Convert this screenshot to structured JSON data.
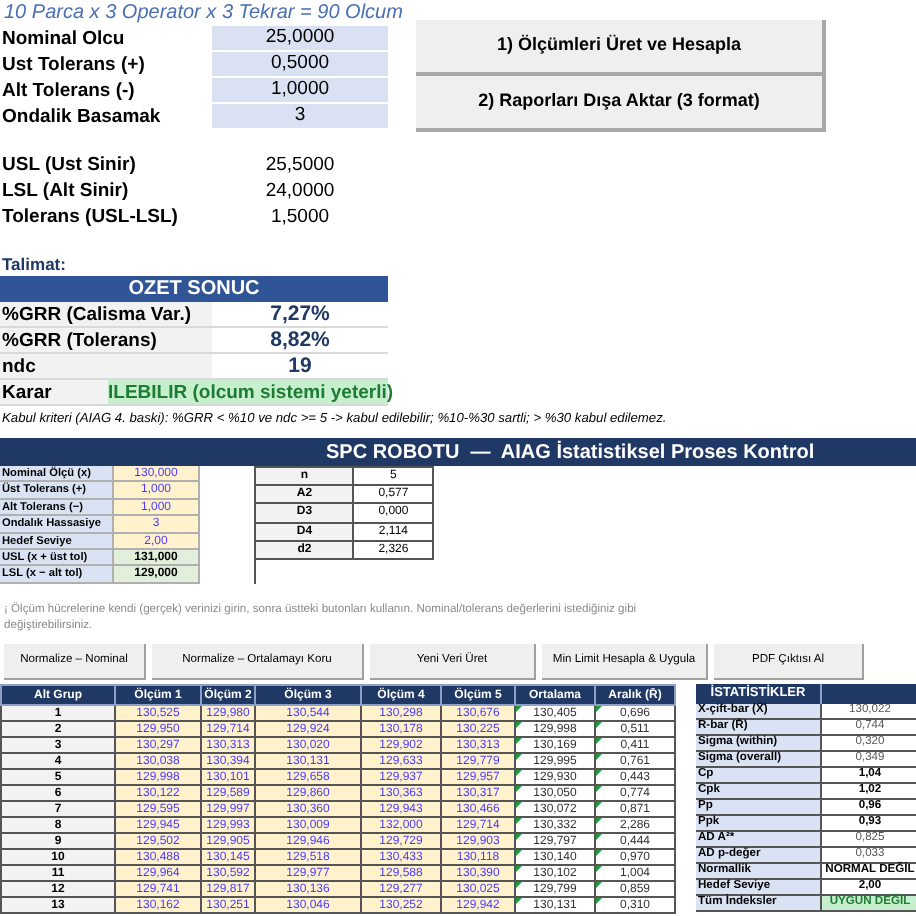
{
  "header_note": "10 Parca x 3 Operator x 3 Tekrar = 90 Olcum",
  "inputs": [
    {
      "label": "Nominal Olcu",
      "value": "25,0000"
    },
    {
      "label": "Ust Tolerans (+)",
      "value": "0,5000"
    },
    {
      "label": "Alt Tolerans (-)",
      "value": "1,0000"
    },
    {
      "label": "Ondalik Basamak",
      "value": "3"
    }
  ],
  "actions": [
    "1) Ölçümleri Üret ve Hesapla",
    "2) Raporları Dışa Aktar (3 format)"
  ],
  "limits": [
    {
      "label": "USL (Ust Sinir)",
      "value": "25,5000"
    },
    {
      "label": "LSL (Alt Sinir)",
      "value": "24,0000"
    },
    {
      "label": "Tolerans (USL-LSL)",
      "value": "1,5000"
    }
  ],
  "instruction_label": "Talimat:",
  "summary": {
    "title": "OZET SONUC",
    "rows": [
      {
        "label": "%GRR (Calisma Var.)",
        "value": "7,27%",
        "kind": "metric"
      },
      {
        "label": "%GRR (Tolerans)",
        "value": "8,82%",
        "kind": "metric"
      },
      {
        "label": "ndc",
        "value": "19",
        "kind": "metric"
      },
      {
        "label": "Karar",
        "value": "ILEBILIR (olcum sistemi yeterli)",
        "kind": "verdict"
      }
    ]
  },
  "criteria_note": "Kabul kriteri (AIAG 4. baski): %GRR < %10 ve ndc >= 5 -> kabul edilebilir; %10-%30 sartli; > %30 kabul edilemez.",
  "spc": {
    "title": "SPC ROBOTU  —  AIAG İstatistiksel Proses Kontrol",
    "params": [
      {
        "label": "Nominal Ölçü (x)",
        "value": "130,000",
        "kind": "input"
      },
      {
        "label": "Üst Tolerans (+)",
        "value": "1,000",
        "kind": "input"
      },
      {
        "label": "Alt Tolerans (−)",
        "value": "1,000",
        "kind": "input"
      },
      {
        "label": "Ondalık Hassasiye",
        "value": "3",
        "kind": "input"
      },
      {
        "label": "Hedef Seviye",
        "value": "2,00",
        "kind": "input"
      },
      {
        "label": "USL  (x + üst tol)",
        "value": "131,000",
        "kind": "limit"
      },
      {
        "label": "LSL  (x − alt tol)",
        "value": "129,000",
        "kind": "limit"
      }
    ],
    "constants": [
      {
        "label": "n",
        "value": "5"
      },
      {
        "label": "A2",
        "value": "0,577"
      },
      {
        "label": "D3",
        "value": "0,000"
      },
      {
        "label": "D4",
        "value": "2,114"
      },
      {
        "label": "d2",
        "value": "2,326"
      }
    ],
    "note": "¡ Ölçüm hücrelerine kendi (gerçek) verinizi girin, sonra üstteki butonları kullanın. Nominal/tolerans değerlerini istediğiniz gibi değiştirebilirsiniz.",
    "buttons": [
      "Normalize – Nominal",
      "Normalize – Ortalamayı Koru",
      "Yeni Veri Üret",
      "Min Limit Hesapla & Uygula",
      "PDF Çıktısı Al"
    ],
    "table": {
      "columns": [
        "Alt Grup",
        "Ölçüm 1",
        "Ölçüm 2",
        "Ölçüm 3",
        "Ölçüm 4",
        "Ölçüm 5",
        "Ortalama",
        "Aralık (R̄)"
      ],
      "rows": [
        [
          "1",
          "130,525",
          "129,980",
          "130,544",
          "130,298",
          "130,676",
          "130,405",
          "0,696"
        ],
        [
          "2",
          "129,950",
          "129,714",
          "129,924",
          "130,178",
          "130,225",
          "129,998",
          "0,511"
        ],
        [
          "3",
          "130,297",
          "130,313",
          "130,020",
          "129,902",
          "130,313",
          "130,169",
          "0,411"
        ],
        [
          "4",
          "130,038",
          "130,394",
          "130,131",
          "129,633",
          "129,779",
          "129,995",
          "0,761"
        ],
        [
          "5",
          "129,998",
          "130,101",
          "129,658",
          "129,937",
          "129,957",
          "129,930",
          "0,443"
        ],
        [
          "6",
          "130,122",
          "129,589",
          "129,860",
          "130,363",
          "130,317",
          "130,050",
          "0,774"
        ],
        [
          "7",
          "129,595",
          "129,997",
          "130,360",
          "129,943",
          "130,466",
          "130,072",
          "0,871"
        ],
        [
          "8",
          "129,945",
          "129,993",
          "130,009",
          "132,000",
          "129,714",
          "130,332",
          "2,286"
        ],
        [
          "9",
          "129,502",
          "129,905",
          "129,946",
          "129,729",
          "129,903",
          "129,797",
          "0,444"
        ],
        [
          "10",
          "130,488",
          "130,145",
          "129,518",
          "130,433",
          "130,118",
          "130,140",
          "0,970"
        ],
        [
          "11",
          "129,964",
          "130,592",
          "129,977",
          "129,588",
          "130,390",
          "130,102",
          "1,004"
        ],
        [
          "12",
          "129,741",
          "129,817",
          "130,136",
          "129,277",
          "130,025",
          "129,799",
          "0,859"
        ],
        [
          "13",
          "130,162",
          "130,251",
          "130,046",
          "130,252",
          "129,942",
          "130,131",
          "0,310"
        ]
      ]
    },
    "stats": {
      "title": "İSTATİSTİKLER",
      "rows": [
        {
          "label": "X-çift-bar (X̄̄)",
          "value": "130,022",
          "kind": "plain"
        },
        {
          "label": "R-bar (R̄)",
          "value": "0,744",
          "kind": "plain"
        },
        {
          "label": "Sigma (within)",
          "value": "0,320",
          "kind": "plain"
        },
        {
          "label": "Sigma (overall)",
          "value": "0,349",
          "kind": "plain"
        },
        {
          "label": "Cp",
          "value": "1,04",
          "kind": "strong"
        },
        {
          "label": "Cpk",
          "value": "1,02",
          "kind": "strong"
        },
        {
          "label": "Pp",
          "value": "0,96",
          "kind": "strong"
        },
        {
          "label": "Ppk",
          "value": "0,93",
          "kind": "strong"
        },
        {
          "label": "AD  A²*",
          "value": "0,825",
          "kind": "plain"
        },
        {
          "label": "AD  p-değer",
          "value": "0,033",
          "kind": "plain"
        },
        {
          "label": "Normallik",
          "value": "NORMAL DEĞİL",
          "kind": "strong"
        },
        {
          "label": "Hedef Seviye",
          "value": "2,00",
          "kind": "strong"
        },
        {
          "label": "Tüm İndeksler",
          "value": "UYGUN DEĞİL",
          "kind": "verdict"
        }
      ]
    }
  }
}
